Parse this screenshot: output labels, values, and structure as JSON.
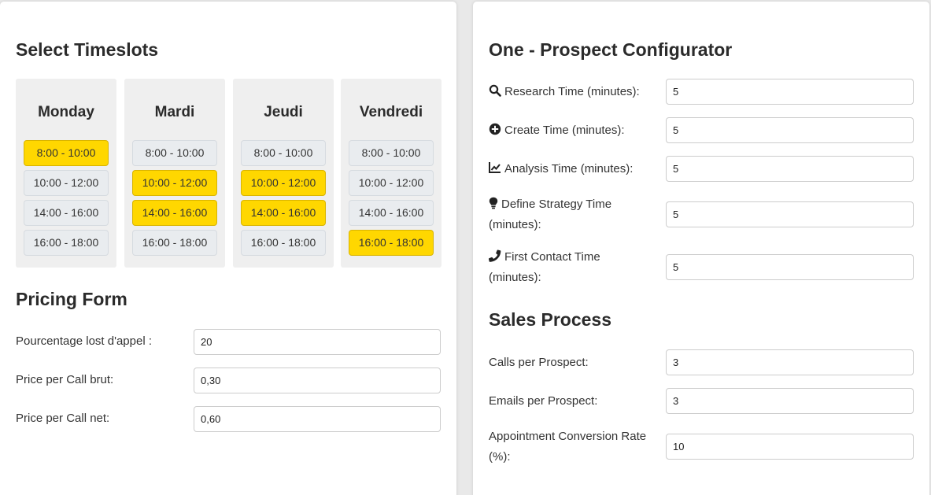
{
  "timeslots": {
    "title": "Select Timeslots",
    "days": [
      {
        "name": "Monday",
        "slots": [
          {
            "label": "8:00 - 10:00",
            "selected": true
          },
          {
            "label": "10:00 - 12:00",
            "selected": false
          },
          {
            "label": "14:00 - 16:00",
            "selected": false
          },
          {
            "label": "16:00 - 18:00",
            "selected": false
          }
        ]
      },
      {
        "name": "Mardi",
        "slots": [
          {
            "label": "8:00 - 10:00",
            "selected": false
          },
          {
            "label": "10:00 - 12:00",
            "selected": true
          },
          {
            "label": "14:00 - 16:00",
            "selected": true
          },
          {
            "label": "16:00 - 18:00",
            "selected": false
          }
        ]
      },
      {
        "name": "Jeudi",
        "slots": [
          {
            "label": "8:00 - 10:00",
            "selected": false
          },
          {
            "label": "10:00 - 12:00",
            "selected": true
          },
          {
            "label": "14:00 - 16:00",
            "selected": true
          },
          {
            "label": "16:00 - 18:00",
            "selected": false
          }
        ]
      },
      {
        "name": "Vendredi",
        "slots": [
          {
            "label": "8:00 - 10:00",
            "selected": false
          },
          {
            "label": "10:00 - 12:00",
            "selected": false
          },
          {
            "label": "14:00 - 16:00",
            "selected": false
          },
          {
            "label": "16:00 - 18:00",
            "selected": true
          }
        ]
      }
    ]
  },
  "pricing": {
    "title": "Pricing Form",
    "fields": [
      {
        "label": "Pourcentage lost d'appel :",
        "value": "20"
      },
      {
        "label": "Price per Call brut:",
        "value": "0,30"
      },
      {
        "label": "Price per Call net:",
        "value": "0,60"
      }
    ]
  },
  "configurator": {
    "title": "One - Prospect Configurator",
    "fields": [
      {
        "icon": "search-icon",
        "label": "Research Time (minutes):",
        "value": "5"
      },
      {
        "icon": "plus-circle-icon",
        "label": "Create Time (minutes):",
        "value": "5"
      },
      {
        "icon": "line-chart-icon",
        "label": "Analysis Time (minutes):",
        "value": "5"
      },
      {
        "icon": "lightbulb-icon",
        "label": "Define Strategy Time (minutes):",
        "value": "5"
      },
      {
        "icon": "phone-icon",
        "label": "First Contact Time (minutes):",
        "value": "5"
      }
    ]
  },
  "sales": {
    "title": "Sales Process",
    "fields": [
      {
        "label": "Calls per Prospect:",
        "value": "3"
      },
      {
        "label": "Emails per Prospect:",
        "value": "3"
      },
      {
        "label": "Appointment Conversion Rate (%):",
        "value": "10"
      }
    ]
  },
  "colors": {
    "selected_slot": "#ffd700",
    "unselected_slot": "#e9ecef",
    "day_column": "#efefef"
  }
}
